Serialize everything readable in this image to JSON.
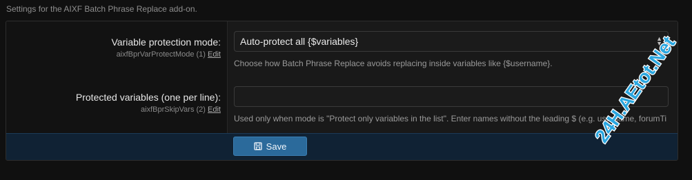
{
  "intro_text": "Settings for the AIXF Batch Phrase Replace add-on.",
  "rows": [
    {
      "label": "Variable protection mode:",
      "meta": "aixfBprVarProtectMode (1)",
      "edit": "Edit",
      "value": "Auto-protect all {$variables}",
      "hint": "Choose how Batch Phrase Replace avoids replacing inside variables like {$username}."
    },
    {
      "label": "Protected variables (one per line):",
      "meta": "aixfBprSkipVars (2)",
      "edit": "Edit",
      "value": "",
      "hint": "Used only when mode is \"Protect only variables in the list\". Enter names without the leading $ (e.g. username, forumTi"
    }
  ],
  "footer": {
    "save_label": "Save"
  },
  "watermark": "24H.AEtot.Net",
  "colors": {
    "accent": "#2b6a9b",
    "watermark": "#2ba7e0"
  },
  "icons": {
    "save": "floppy-disk-icon",
    "select": "select-arrows-icon"
  }
}
